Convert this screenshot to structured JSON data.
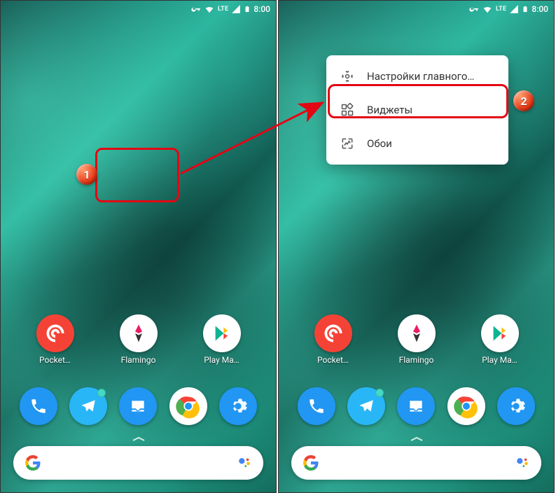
{
  "status": {
    "lte": "LTE",
    "time": "8:00"
  },
  "apps_row": [
    {
      "label": "Pocket…",
      "bg": "#f44336"
    },
    {
      "label": "Flamingo",
      "bg": "#ffffff"
    },
    {
      "label": "Play Ма…",
      "bg": "#ffffff"
    }
  ],
  "dock": [
    {
      "name": "phone",
      "bg": "#2196f3"
    },
    {
      "name": "telegram",
      "bg": "#2196f3"
    },
    {
      "name": "inbox",
      "bg": "#2196f3"
    },
    {
      "name": "chrome",
      "bg": "#ffffff"
    },
    {
      "name": "settings",
      "bg": "#2196f3"
    }
  ],
  "context_menu": {
    "settings": "Настройки главного…",
    "widgets": "Виджеты",
    "wallpaper": "Обои"
  },
  "badges": {
    "b1": "1",
    "b2": "2"
  }
}
